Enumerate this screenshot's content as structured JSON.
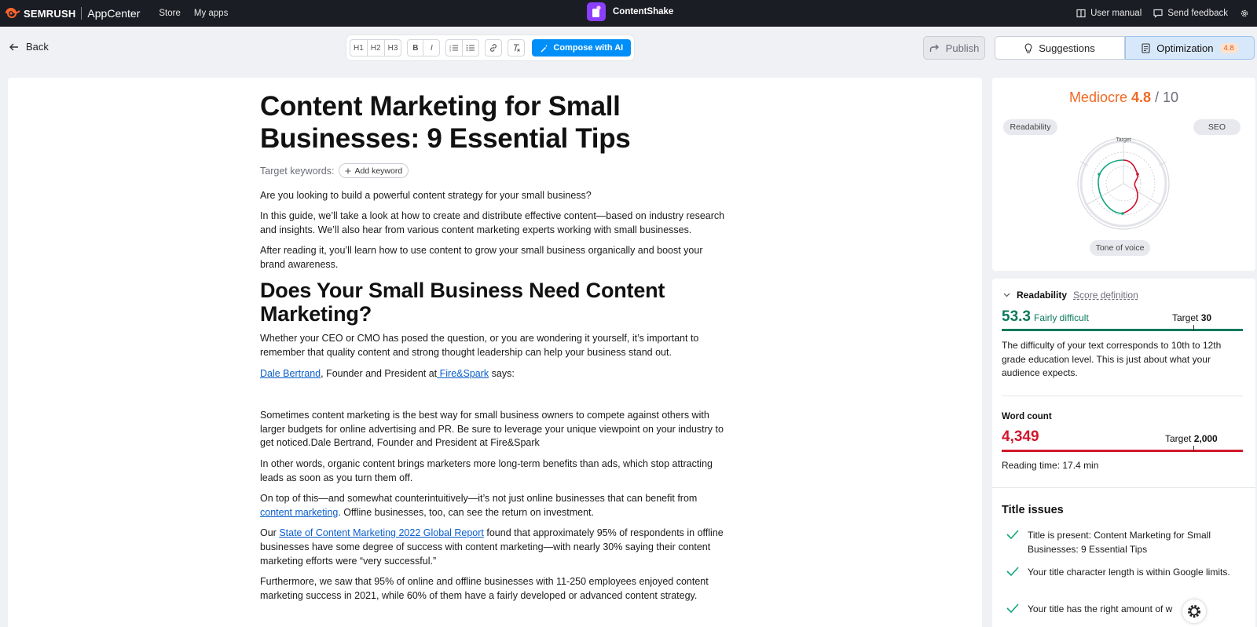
{
  "topbar": {
    "brand": "SEMRUSH",
    "appcenter": "AppCenter",
    "nav": [
      "Store",
      "My apps"
    ],
    "app_name": "ContentShake",
    "user_manual": "User manual",
    "send_feedback": "Send feedback"
  },
  "toolbar": {
    "back": "Back",
    "format_buttons": [
      "H1",
      "H2",
      "H3",
      "B",
      "I"
    ],
    "compose": "Compose with AI",
    "publish": "Publish",
    "tab_suggestions": "Suggestions",
    "tab_optimization": "Optimization",
    "optimization_badge": "4.8"
  },
  "doc": {
    "title": "Content Marketing for Small Businesses: 9 Essential Tips",
    "target_keywords_label": "Target keywords:",
    "add_keyword": "Add keyword",
    "p1": "Are you looking to build a powerful content strategy for your small business?",
    "p2": "In this guide, we’ll take a look at how to create and distribute effective content—based on industry research and insights. We’ll also hear from various content marketing experts working with small businesses.",
    "p3": "After reading it, you’ll learn how to use content to grow your small business organically and boost your brand awareness.",
    "h2": "Does Your Small Business Need Content Marketing?",
    "p4": "Whether your CEO or CMO has posed the question, or you are wondering it yourself, it’s important to remember that quality content and strong thought leadership can help your business stand out.",
    "p5_link1": "Dale Bertrand",
    "p5_mid": ", Founder and President at",
    "p5_link2": " Fire&Spark",
    "p5_end": " says:",
    "quote": "Sometimes content marketing is the best way for small business owners to compete against others with larger budgets for online advertising and PR. Be sure to leverage your unique viewpoint on your industry to get noticed.Dale Bertrand, Founder and President at Fire&Spark",
    "p6": "In other words, organic content brings marketers more long-term benefits than ads, which stop attracting leads as soon as you turn them off.",
    "p7_a": "On top of this—and somewhat counterintuitively—it’s not just online businesses that can benefit from ",
    "p7_link": "content marketing",
    "p7_b": ". Offline businesses, too, can see the return on investment.",
    "p8_a": "Our ",
    "p8_link": "State of Content Marketing 2022 Global Report",
    "p8_b": " found that approximately 95% of respondents in offline businesses have some degree of success with content marketing—with nearly 30% saying their content marketing efforts were “very successful.”",
    "p9": "Furthermore, we saw that 95% of online and offline businesses with 11-250 employees enjoyed content marketing success in 2021, while 60% of them have a fairly developed or advanced content strategy."
  },
  "score": {
    "word": "Mediocre",
    "value": "4.8",
    "max": "/ 10",
    "pill_readability": "Readability",
    "pill_seo": "SEO",
    "pill_tone": "Tone of voice",
    "radar_target": "Target"
  },
  "readability": {
    "title": "Readability",
    "definition": "Score definition",
    "value": "53.3",
    "level": "Fairly difficult",
    "target_label": "Target",
    "target_value": "30",
    "description": "The difficulty of your text corresponds to 10th to 12th grade education level. This is just about what your audience expects.",
    "word_count_title": "Word count",
    "word_count": "4,349",
    "wc_target_label": "Target",
    "wc_target_value": "2,000",
    "reading_time": "Reading time: 17.4 min"
  },
  "title_issues": {
    "heading": "Title issues",
    "items": [
      "Title is present: Content Marketing for Small Businesses: 9 Essential Tips",
      "Your title character length is within Google limits.",
      "Your title has the right amount of w"
    ]
  },
  "colors": {
    "accent_blue": "#008ff8",
    "score_orange": "#f06a25",
    "good_green": "#0a7a5c",
    "bad_red": "#d1182c"
  }
}
